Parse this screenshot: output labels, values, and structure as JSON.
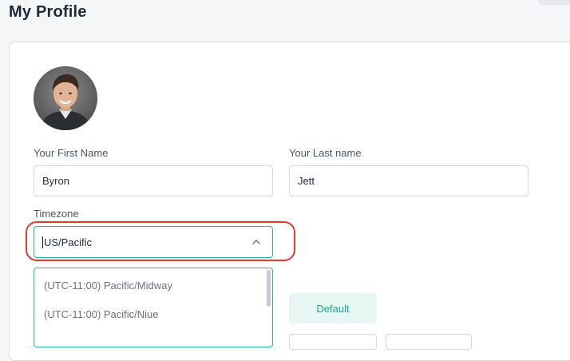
{
  "page": {
    "title": "My Profile"
  },
  "profile": {
    "first_name_label": "Your First Name",
    "first_name_value": "Byron",
    "last_name_label": "Your Last name",
    "last_name_value": "Jett",
    "timezone_label": "Timezone",
    "timezone_value": "US/Pacific"
  },
  "timezone_dropdown": {
    "options": [
      "(UTC-11:00) Pacific/Midway",
      "(UTC-11:00) Pacific/Niue"
    ]
  },
  "actions": {
    "default_label": "Default"
  },
  "colors": {
    "accent": "#21b8a3",
    "highlight": "#e2392d",
    "default_btn_bg": "#e8f7f4"
  }
}
